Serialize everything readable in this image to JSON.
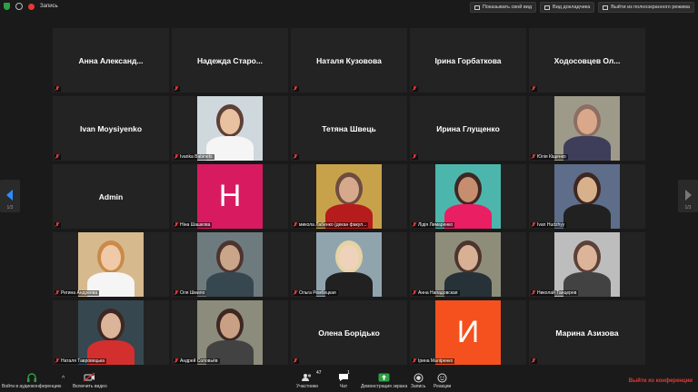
{
  "topbar": {
    "recording_label": "Запись",
    "show_video_label": "Показывать свой вид",
    "gallery_view_label": "Вид докладчика",
    "exit_fullscreen_label": "Выйти из полноэкранного режима"
  },
  "pagination": {
    "left": "1/3",
    "right": "1/3"
  },
  "participants": [
    {
      "display": "Анна  Александ...",
      "label": "",
      "kind": "name"
    },
    {
      "display": "Надежда  Старо...",
      "label": "",
      "kind": "name"
    },
    {
      "display": "Наталя Кузовова",
      "label": "",
      "kind": "name"
    },
    {
      "display": "Ірина Горбаткова",
      "label": "",
      "kind": "name"
    },
    {
      "display": "Ходосовцев  Ол...",
      "label": "",
      "kind": "name"
    },
    {
      "display": "Ivan Moysiyenko",
      "label": "",
      "kind": "name"
    },
    {
      "display": "",
      "label": "Ivanka Babinets",
      "kind": "photo",
      "bg": "#cfd8dc",
      "skin": "#e8c1a0",
      "shirt": "#f5f5f5",
      "hair": "#5d4037"
    },
    {
      "display": "Тетяна Швець",
      "label": "",
      "kind": "name"
    },
    {
      "display": "Ирина Глущенко",
      "label": "",
      "kind": "name"
    },
    {
      "display": "",
      "label": "Юлія Кіщенко",
      "kind": "photo",
      "bg": "#9e9a8a",
      "skin": "#d9a88a",
      "shirt": "#3e3e5a",
      "hair": "#8d6e63"
    },
    {
      "display": "Admin",
      "label": "",
      "kind": "name"
    },
    {
      "display": "",
      "label": "Ніна Шашкова",
      "kind": "letter",
      "letter": "H",
      "color": "#d81b60"
    },
    {
      "display": "",
      "label": "микола Лабенко (декан факул...",
      "kind": "photo",
      "bg": "#c8a24a",
      "skin": "#d7a98c",
      "shirt": "#b71c1c",
      "hair": "#6d4c41"
    },
    {
      "display": "",
      "label": "Лідія Лимаренко",
      "kind": "photo",
      "bg": "#4db6ac",
      "skin": "#c68e6e",
      "shirt": "#e91e63",
      "hair": "#3e2723"
    },
    {
      "display": "",
      "label": "Ivan Hudzhyy",
      "kind": "photo",
      "bg": "#5d6d8a",
      "skin": "#d9b08c",
      "shirt": "#212121",
      "hair": "#3e2723"
    },
    {
      "display": "",
      "label": "Регина Андреева",
      "kind": "photo",
      "bg": "#d7b98e",
      "skin": "#f0c9a8",
      "shirt": "#f5f5f5",
      "hair": "#c98b4a"
    },
    {
      "display": "",
      "label": "Оля Шмило",
      "kind": "photo",
      "bg": "#6d7b7f",
      "skin": "#c9a58a",
      "shirt": "#37474f",
      "hair": "#4e342e"
    },
    {
      "display": "",
      "label": "Ольга Рембецкая",
      "kind": "photo",
      "bg": "#90a4ae",
      "skin": "#eed2bc",
      "shirt": "#212121",
      "hair": "#e6d3a3"
    },
    {
      "display": "",
      "label": "Анна Нападовская",
      "kind": "photo",
      "bg": "#8d8d7a",
      "skin": "#d8b094",
      "shirt": "#263238",
      "hair": "#4e342e"
    },
    {
      "display": "",
      "label": "Николай Танцерев",
      "kind": "photo",
      "bg": "#bdbdbd",
      "skin": "#dcb49a",
      "shirt": "#424242",
      "hair": "#5d4037"
    },
    {
      "display": "",
      "label": "Наталя Тавровецька",
      "kind": "photo",
      "bg": "#37474f",
      "skin": "#dcb49a",
      "shirt": "#d32f2f",
      "hair": "#3e2723"
    },
    {
      "display": "",
      "label": "Андрей Соловьёв",
      "kind": "photo",
      "bg": "#8c8c7c",
      "skin": "#c9a084",
      "shirt": "#424242",
      "hair": "#3e2723"
    },
    {
      "display": "Олена Борідько",
      "label": "",
      "kind": "name"
    },
    {
      "display": "",
      "label": "Ірина Маліренко",
      "kind": "letter",
      "letter": "И",
      "color": "#f4511e"
    },
    {
      "display": "Марина Азизова",
      "label": "",
      "kind": "name"
    }
  ],
  "bottombar": {
    "audio_label": "Войти в аудиоконференцию",
    "video_label": "Включить видео",
    "participants_label": "Участники",
    "participants_count": "47",
    "chat_label": "Чат",
    "chat_count": "1",
    "share_label": "Демонстрация экрана",
    "record_label": "Запись",
    "reactions_label": "Реакции",
    "leave_label": "Выйти из конференции"
  },
  "colors": {
    "accent": "#2d8cff",
    "chat": "#ff7a1a",
    "leave": "#e53935",
    "share": "#2ea043"
  },
  "icons": [
    "shield-icon",
    "info-icon",
    "record-icon",
    "headphones-icon",
    "video-off-icon",
    "participants-icon",
    "chat-icon",
    "share-screen-icon",
    "record-button-icon",
    "reactions-icon",
    "mic-muted-icon"
  ]
}
